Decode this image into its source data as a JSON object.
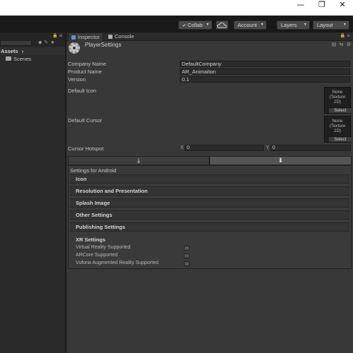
{
  "window": {
    "minimize": "—",
    "restore": "❐",
    "close": "✕"
  },
  "toolbar": {
    "collab": "Collab",
    "cloud_icon": "cloud-icon",
    "account": "Account",
    "layers": "Layers",
    "layout": "Layout",
    "dropdown_glyph": "▾",
    "check_glyph": "✔"
  },
  "left_panel": {
    "assets_label": "Assets",
    "assets_arrow": "›",
    "folder_item": "Scenes",
    "icon_glyphs": "◆✎★",
    "lock_glyph": "🔒 ≡"
  },
  "inspector": {
    "tabs": [
      {
        "label": "Inspector"
      },
      {
        "label": "Console"
      }
    ],
    "tab_menu_glyph": "🔒 ≡",
    "header_title": "PlayerSettings",
    "header_icons": "▤ ⇆ ⚙",
    "company_name_label": "Company Name",
    "company_name_value": "DefaultCompany",
    "product_name_label": "Product Name",
    "product_name_value": "AR_Animaiton",
    "version_label": "Version",
    "version_value": "0.1",
    "default_icon_label": "Default Icon",
    "default_icon_texture": {
      "line1": "None",
      "line2": "(Texture",
      "line3": "2D)",
      "select": "Select"
    },
    "default_cursor_label": "Default Cursor",
    "default_cursor_texture": {
      "line1": "None",
      "line2": "(Texture",
      "line3": "2D)",
      "select": "Select"
    },
    "cursor_hotspot_label": "Cursor Hotspot",
    "hotspot_x_label": "X",
    "hotspot_x_value": "0",
    "hotspot_y_label": "Y",
    "hotspot_y_value": "0",
    "platform_icon_standalone": "⤓",
    "platform_icon_android": "⬇",
    "settings_for": "Settings for Android",
    "sections": [
      {
        "label": "Icon"
      },
      {
        "label": "Resolution and Presentation"
      },
      {
        "label": "Splash Image"
      },
      {
        "label": "Other Settings"
      },
      {
        "label": "Publishing Settings"
      }
    ],
    "xr": {
      "title": "XR Settings",
      "rows": [
        {
          "label": "Virtual Reality Supported",
          "checked": false
        },
        {
          "label": "ARCore Supported",
          "checked": false
        },
        {
          "label": "Vuforia Augmented Reality Supported",
          "checked": false
        }
      ]
    }
  },
  "colors": {
    "accent": "#4d7bd0",
    "background": "#383838",
    "toolbar": "#191919"
  }
}
